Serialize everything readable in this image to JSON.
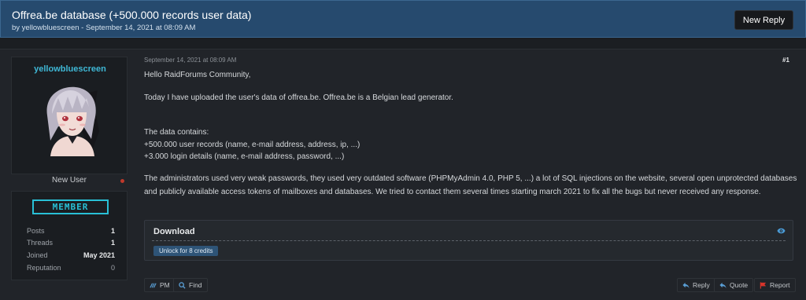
{
  "thread": {
    "title": "Offrea.be database (+500.000 records user data)",
    "byline": "by yellowbluescreen - September 14, 2021 at 08:09 AM",
    "new_reply_label": "New Reply"
  },
  "user": {
    "name": "yellowbluescreen",
    "title": "New User",
    "badge": "MEMBER",
    "stats": [
      {
        "label": "Posts",
        "value": "1"
      },
      {
        "label": "Threads",
        "value": "1"
      },
      {
        "label": "Joined",
        "value": "May 2021"
      },
      {
        "label": "Reputation",
        "value": "0"
      }
    ]
  },
  "post": {
    "date": "September 14, 2021 at 08:09 AM",
    "number": "#1",
    "greeting": "Hello RaidForums Community,",
    "intro": "Today I have uploaded the user's data of offrea.be. Offrea.be is a Belgian lead generator.",
    "contains_heading": "The data contains:",
    "contains_1": "+500.000 user records (name, e-mail address, address, ip, ...)",
    "contains_2": "+3.000 login details (name, e-mail address, password, ...)",
    "closing": "The administrators used very weak passwords, they used very outdated software (PHPMyAdmin 4.0, PHP 5, ...) a lot of SQL injections on the website, several open unprotected databases and publicly available access tokens of mailboxes and databases. We tried to contact them several times starting march 2021 to fix all the bugs but never received any response."
  },
  "download": {
    "title": "Download",
    "unlock_label": "Unlock for 8 credits"
  },
  "actions": {
    "pm": "PM",
    "find": "Find",
    "reply": "Reply",
    "quote": "Quote",
    "report": "Report"
  },
  "colors": {
    "header_bg": "#264a6e",
    "username": "#3fb8d6",
    "badge": "#29c0d6",
    "offline": "#c0392b",
    "report_flag": "#d9342b"
  }
}
